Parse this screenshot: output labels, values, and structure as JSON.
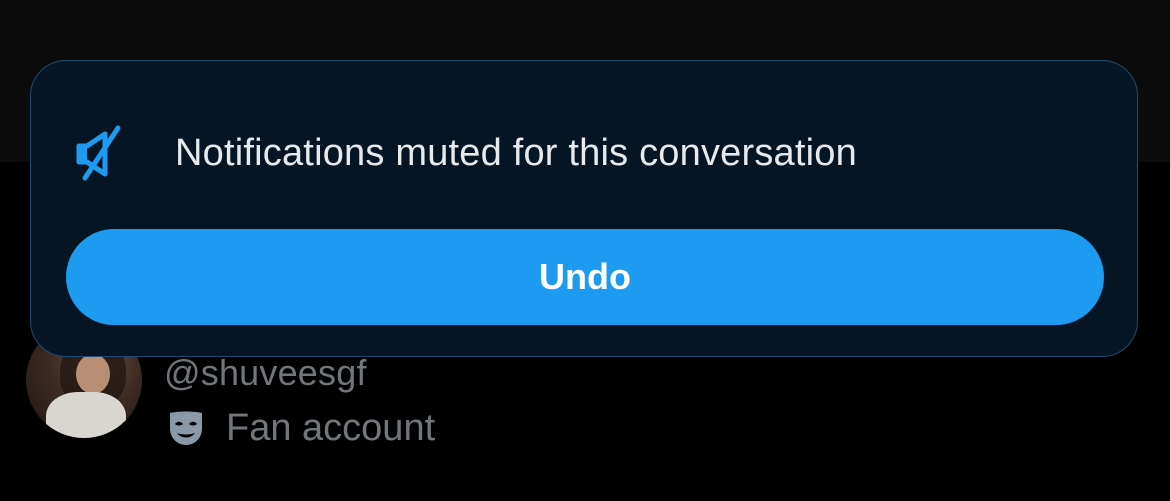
{
  "profile": {
    "handle": "@shuveesgf",
    "category_label": "Fan account",
    "category_icon": "theater-mask-icon"
  },
  "toast": {
    "icon": "notifications-muted-icon",
    "message": "Notifications muted for this conversation",
    "undo_label": "Undo"
  },
  "colors": {
    "accent": "#1d9bf0",
    "toast_background": "#061523",
    "toast_border": "#1d4a70",
    "secondary_text": "#71767b",
    "primary_text": "#e7e9ea"
  }
}
